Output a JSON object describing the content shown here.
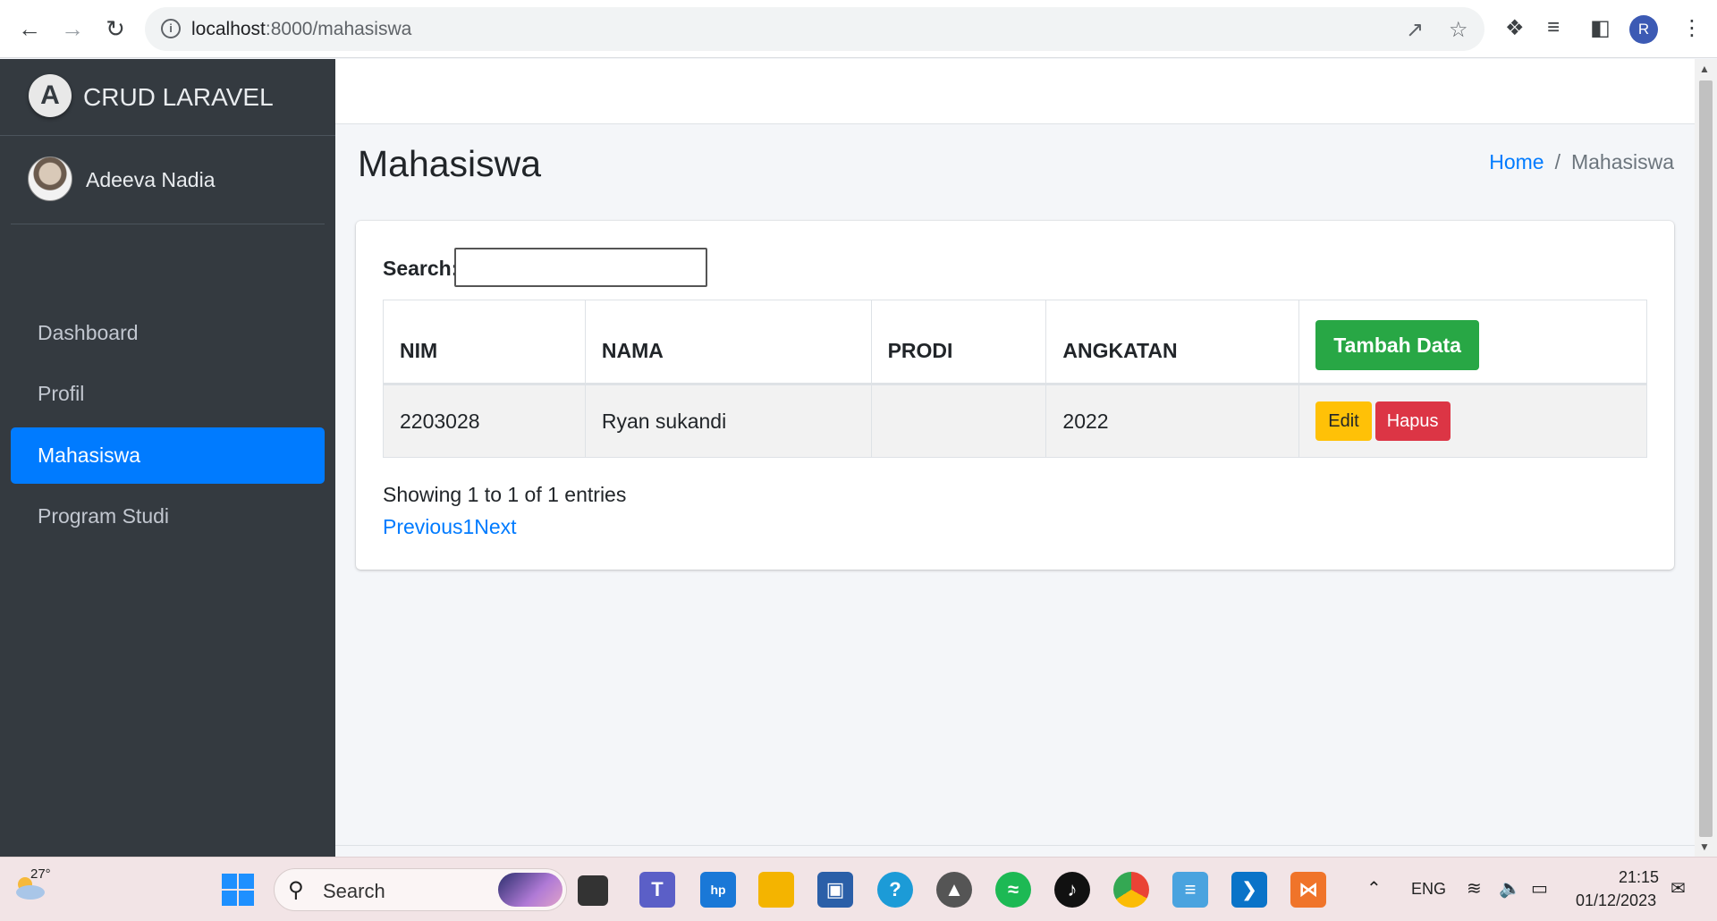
{
  "browser": {
    "url_host": "localhost",
    "url_path": ":8000/mahasiswa",
    "profile_initial": "R"
  },
  "sidebar": {
    "brand": "CRUD LARAVEL",
    "brand_logo_letter": "A",
    "user_name": "Adeeva Nadia",
    "items": [
      {
        "label": "Dashboard",
        "active": false
      },
      {
        "label": "Profil",
        "active": false
      },
      {
        "label": "Mahasiswa",
        "active": true
      },
      {
        "label": "Program Studi",
        "active": false
      }
    ]
  },
  "page": {
    "title": "Mahasiswa",
    "breadcrumb_home": "Home",
    "breadcrumb_sep": "/",
    "breadcrumb_current": "Mahasiswa"
  },
  "table": {
    "search_label": "Search:",
    "search_value": "",
    "columns": [
      "NIM",
      "NAMA",
      "PRODI",
      "ANGKATAN"
    ],
    "add_button": "Tambah Data",
    "rows": [
      {
        "nim": "2203028",
        "nama": "Ryan sukandi",
        "prodi": "",
        "angkatan": "2022",
        "edit_label": "Edit",
        "delete_label": "Hapus"
      }
    ],
    "info": "Showing 1 to 1 of 1 entries",
    "pager_prev": "Previous",
    "pager_page": "1",
    "pager_next": "Next"
  },
  "taskbar": {
    "weather_temp": "27°",
    "search_placeholder": "Search",
    "language": "ENG",
    "time": "21:15",
    "date": "01/12/2023"
  },
  "colors": {
    "sidebar_bg": "#343a40",
    "active_item": "#007bff",
    "add_button": "#28a745",
    "edit_button": "#ffc107",
    "delete_button": "#dc3545"
  }
}
